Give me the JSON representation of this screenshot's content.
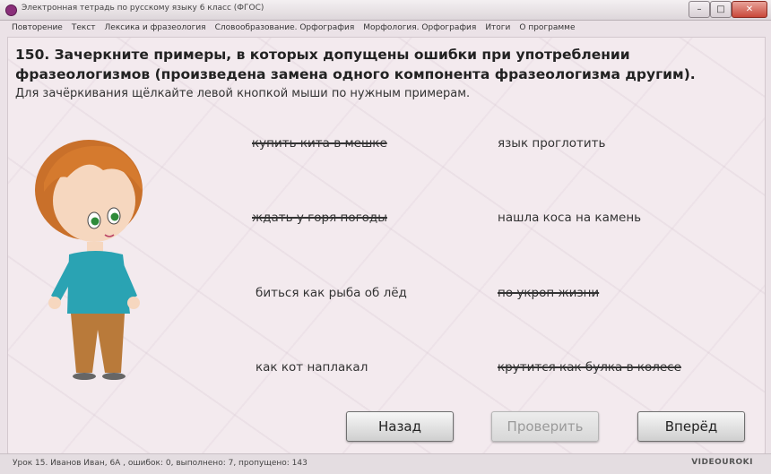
{
  "window": {
    "title": "Электронная тетрадь по русскому языку 6 класс (ФГОС)",
    "min": "–",
    "max": "□",
    "close": "✕"
  },
  "menu": [
    "Повторение",
    "Текст",
    "Лексика и фразеология",
    "Словообразование. Орфография",
    "Морфология. Орфография",
    "Итоги",
    "О программе"
  ],
  "task": {
    "heading": "150. Зачеркните примеры, в которых допущены ошибки при употреблении фразеологизмов (произведена замена одного компонента фразеологизма другим).",
    "instruction": "Для зачёркивания щёлкайте левой кнопкой мыши по нужным примерам."
  },
  "phrases": [
    {
      "text": "купить кита в мешке",
      "struck": true
    },
    {
      "text": "язык проглотить",
      "struck": false
    },
    {
      "text": "ждать у горя погоды",
      "struck": true
    },
    {
      "text": "нашла коса на камень",
      "struck": false
    },
    {
      "text": "биться как рыба об лёд",
      "struck": false
    },
    {
      "text": "по укроп жизни",
      "struck": true
    },
    {
      "text": "как кот наплакал",
      "struck": false
    },
    {
      "text": "крутится как булка в колесе",
      "struck": true
    }
  ],
  "buttons": {
    "back": "Назад",
    "check": "Проверить",
    "next": "Вперёд"
  },
  "status": {
    "text": "Урок 15. Иванов Иван, 6А , ошибок: 0, выполнено: 7, пропущено: 143",
    "logo": "VIDEOUROKI"
  },
  "icons": {
    "app": "app-icon",
    "character": "boy-character"
  }
}
